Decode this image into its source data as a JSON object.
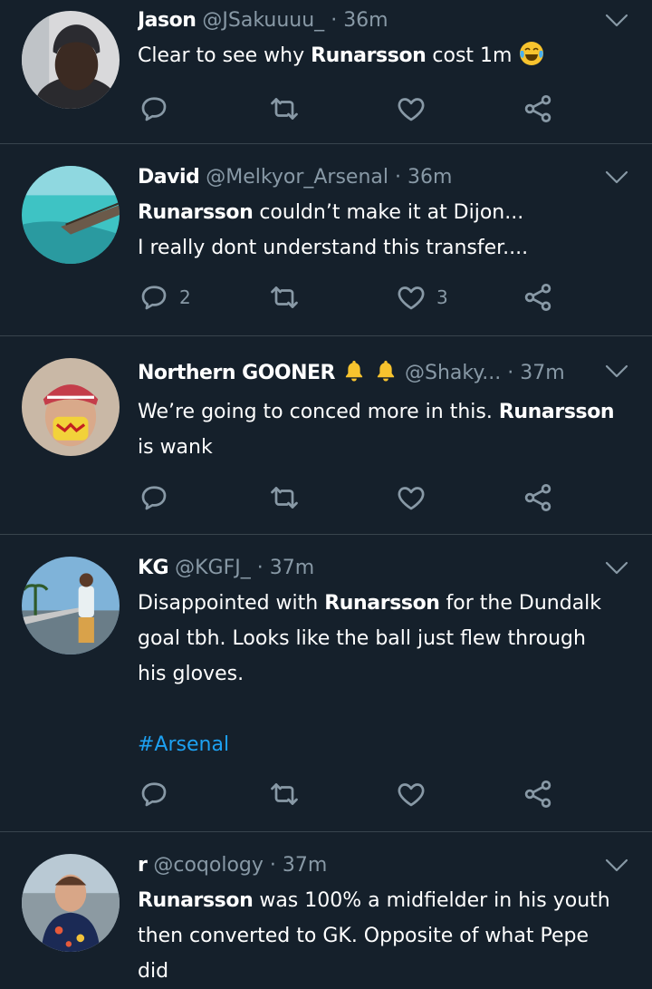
{
  "colors": {
    "background": "#15202b",
    "divider": "#38444d",
    "secondary": "#8899a6",
    "link": "#1da1f2",
    "emoji": "#f7c32e"
  },
  "tweets": [
    {
      "name": "Jason",
      "handle": "@JSakuuuu_",
      "time": "36m",
      "lines": [
        {
          "pre": "Clear to see why ",
          "bold": "Runarsson",
          "post": " cost 1m"
        }
      ],
      "emoji": "face-with-tears-of-joy",
      "replies": "",
      "likes": ""
    },
    {
      "name": "David",
      "handle": "@Melkyor_Arsenal",
      "time": "36m",
      "lines": [
        {
          "pre": "",
          "bold": "Runarsson",
          "post": " couldn’t make it at Dijon..."
        },
        {
          "pre": "I really dont understand this transfer....",
          "bold": "",
          "post": ""
        }
      ],
      "replies": "2",
      "likes": "3"
    },
    {
      "name": "Northern GOONER",
      "name_icons": [
        "bell-icon",
        "bell-icon"
      ],
      "handle": "@Shaky...",
      "time": "37m",
      "lines": [
        {
          "pre": "We’re going to conced more in this. ",
          "bold": "Runarsson",
          "post": ""
        },
        {
          "pre": "is wank",
          "bold": "",
          "post": ""
        }
      ],
      "replies": "",
      "likes": ""
    },
    {
      "name": "KG",
      "handle": "@KGFJ_",
      "time": "37m",
      "lines": [
        {
          "pre": "Disappointed with ",
          "bold": "Runarsson",
          "post": " for the Dundalk"
        },
        {
          "pre": "goal tbh. Looks like the ball just flew through",
          "bold": "",
          "post": ""
        },
        {
          "pre": "his gloves.",
          "bold": "",
          "post": ""
        }
      ],
      "hashtag": "#Arsenal",
      "replies": "",
      "likes": ""
    },
    {
      "name": "r",
      "handle": "@coqology",
      "time": "37m",
      "lines": [
        {
          "pre": "",
          "bold": "Runarsson",
          "post": " was 100% a midfielder in his youth"
        },
        {
          "pre": "then converted to GK. Opposite of what Pepe",
          "bold": "",
          "post": ""
        },
        {
          "pre": "did",
          "bold": "",
          "post": ""
        }
      ],
      "replies": "",
      "likes": ""
    }
  ]
}
